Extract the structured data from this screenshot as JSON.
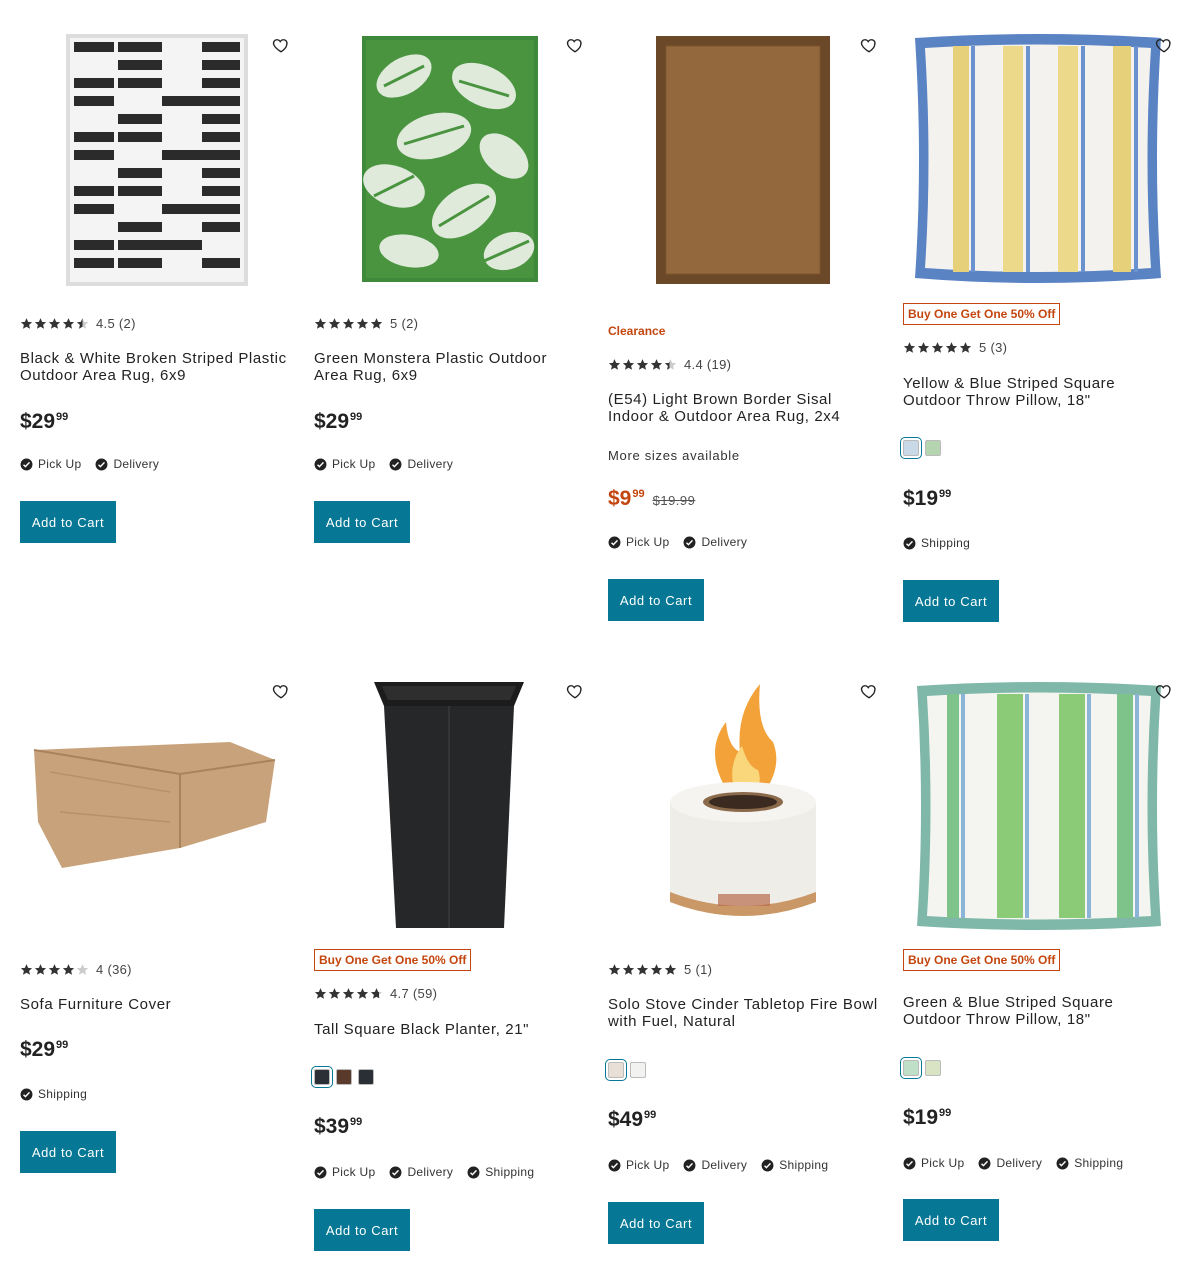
{
  "accent_color": "#067895",
  "sale_color": "#c4460f",
  "products": [
    {
      "title": "Black & White Broken Striped Plastic Outdoor Area Rug, 6x9",
      "rating": "4.5",
      "reviews": "(2)",
      "stars": 4.5,
      "price_main": "$29",
      "price_cents": "99",
      "fulfillment": [
        "Pick Up",
        "Delivery"
      ],
      "button": "Add to Cart",
      "image": "black-white-striped-rug-image"
    },
    {
      "title": "Green Monstera Plastic Outdoor Area Rug, 6x9",
      "rating": "5",
      "reviews": "(2)",
      "stars": 5,
      "price_main": "$29",
      "price_cents": "99",
      "fulfillment": [
        "Pick Up",
        "Delivery"
      ],
      "button": "Add to Cart",
      "image": "green-monstera-rug-image"
    },
    {
      "label": "Clearance",
      "title": "(E54) Light Brown Border Sisal Indoor & Outdoor Area Rug, 2x4",
      "rating": "4.4",
      "reviews": "(19)",
      "stars": 4.4,
      "sizes": "More sizes available",
      "price_main": "$9",
      "price_cents": "99",
      "was_price": "$19.99",
      "fulfillment": [
        "Pick Up",
        "Delivery"
      ],
      "button": "Add to Cart",
      "image": "brown-sisal-rug-image"
    },
    {
      "badge": "Buy One Get One 50% Off",
      "title": "Yellow & Blue Striped Square Outdoor Throw Pillow, 18\"",
      "rating": "5",
      "reviews": "(3)",
      "stars": 5,
      "swatches": [
        "#c9d9e8",
        "#b5d4b0"
      ],
      "price_main": "$19",
      "price_cents": "99",
      "fulfillment": [
        "Shipping"
      ],
      "button": "Add to Cart",
      "image": "yellow-blue-pillow-image"
    },
    {
      "title": "Sofa Furniture Cover",
      "rating": "4",
      "reviews": "(36)",
      "stars": 4,
      "price_main": "$29",
      "price_cents": "99",
      "fulfillment": [
        "Shipping"
      ],
      "button": "Add to Cart",
      "image": "sofa-cover-image"
    },
    {
      "badge": "Buy One Get One 50% Off",
      "title": "Tall Square Black Planter, 21\"",
      "rating": "4.7",
      "reviews": "(59)",
      "stars": 4.7,
      "swatches": [
        "#2b3036",
        "#5a3a2a",
        "#2a2f36"
      ],
      "price_main": "$39",
      "price_cents": "99",
      "fulfillment": [
        "Pick Up",
        "Delivery",
        "Shipping"
      ],
      "button": "Add to Cart",
      "image": "black-planter-image"
    },
    {
      "title": "Solo Stove Cinder Tabletop Fire Bowl with Fuel, Natural",
      "rating": "5",
      "reviews": "(1)",
      "stars": 5,
      "swatches": [
        "#e8e0d6",
        "#f2f2f0"
      ],
      "price_main": "$49",
      "price_cents": "99",
      "fulfillment": [
        "Pick Up",
        "Delivery",
        "Shipping"
      ],
      "button": "Add to Cart",
      "image": "fire-bowl-image"
    },
    {
      "badge": "Buy One Get One 50% Off",
      "title": "Green & Blue Striped Square Outdoor Throw Pillow, 18\"",
      "rating": "",
      "reviews": "",
      "stars": 0,
      "swatches": [
        "#bfe0c6",
        "#d9e4c4"
      ],
      "price_main": "$19",
      "price_cents": "99",
      "fulfillment": [
        "Pick Up",
        "Delivery",
        "Shipping"
      ],
      "button": "Add to Cart",
      "image": "green-blue-pillow-image"
    }
  ]
}
